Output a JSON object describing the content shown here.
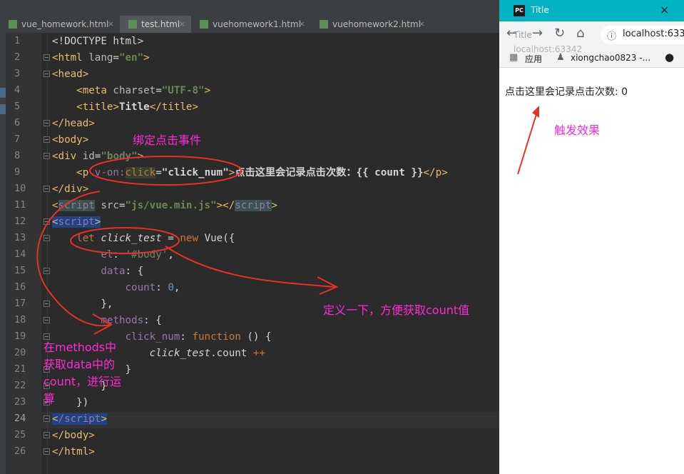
{
  "editor": {
    "tabs": [
      {
        "label": "vue_homework.html",
        "active": false
      },
      {
        "label": "test.html",
        "active": true
      },
      {
        "label": "vuehomework1.html",
        "active": false
      },
      {
        "label": "vuehomework2.html",
        "active": false
      }
    ],
    "close_glyph": "×",
    "line_numbers": [
      "1",
      "2",
      "3",
      "4",
      "5",
      "6",
      "7",
      "8",
      "9",
      "10",
      "11",
      "12",
      "13",
      "14",
      "15",
      "16",
      "17",
      "18",
      "19",
      "20",
      "21",
      "22",
      "23",
      "24",
      "25",
      "26"
    ],
    "lines": {
      "l1": "<!DOCTYPE html>",
      "l2a": "<html ",
      "l2b": "lang",
      "l2c": "=",
      "l2d": "\"en\"",
      "l2e": ">",
      "l3": "<head>",
      "l4a": "    <meta ",
      "l4b": "charset",
      "l4c": "=",
      "l4d": "\"UTF-8\"",
      "l4e": ">",
      "l5a": "    <title>",
      "l5b": "Title",
      "l5c": "</title>",
      "l6": "</head>",
      "l7": "<body>",
      "l8a": "<div ",
      "l8b": "id",
      "l8c": "=",
      "l8d": "\"body\"",
      "l8e": ">",
      "l9a": "    <p ",
      "l9b": "v-on",
      "l9c": ":",
      "l9d": "click",
      "l9e": "=",
      "l9f": "\"click_num\"",
      "l9g": ">",
      "l9h": "点击这里会记录点击次数：{{ count }}",
      "l9i": "</p>",
      "l10": "</div>",
      "l11a": "<",
      "l11b": "script",
      "l11c": " src",
      "l11d": "=",
      "l11e": "\"js/vue.min.js\"",
      "l11f": "></",
      "l11g": "script",
      "l11h": ">",
      "l12a": "<",
      "l12b": "script",
      "l12c": ">",
      "l13a": "    let ",
      "l13b": "click_test",
      "l13c": " = ",
      "l13d": "new ",
      "l13e": "Vue({",
      "l14a": "        el",
      "l14b": ": ",
      "l14c": "'#body'",
      "l14d": ",",
      "l15a": "        data",
      "l15b": ": {",
      "l16a": "            count",
      "l16b": ": ",
      "l16c": "0",
      "l16d": ",",
      "l17": "        },",
      "l18a": "        methods",
      "l18b": ": {",
      "l19a": "            click_num",
      "l19b": ": ",
      "l19c": "function ",
      "l19d": "() {",
      "l20a": "                ",
      "l20b": "click_test",
      "l20c": ".count ",
      "l20d": "++",
      "l21": "            }",
      "l22": "        }",
      "l23": "    })",
      "l24a": "<",
      "l24b": "/script",
      "l24c": ">",
      "l25": "</body>",
      "l26": "</html>"
    }
  },
  "annotations": {
    "bind_click": "绑定点击事件",
    "define": "定义一下，方便获取count值",
    "methods_note_1": "在methods中",
    "methods_note_2": "获取data中的",
    "methods_note_3": "count，进行运",
    "methods_note_4": "算",
    "trigger": "触发效果"
  },
  "browser": {
    "tab_title": "Title",
    "close_glyph": "×",
    "address": "localhost:633",
    "tooltip_title": "Title",
    "tooltip_url": "localhost:63342",
    "bookmark_apps": "应用",
    "bookmark_user": "xiongchao0823 -...",
    "content": "点击这里会记录点击次数: 0",
    "colors": {
      "titlebar": "#00b4c5",
      "annotation": "#ff2bd6",
      "arrow": "#e8302a"
    }
  }
}
